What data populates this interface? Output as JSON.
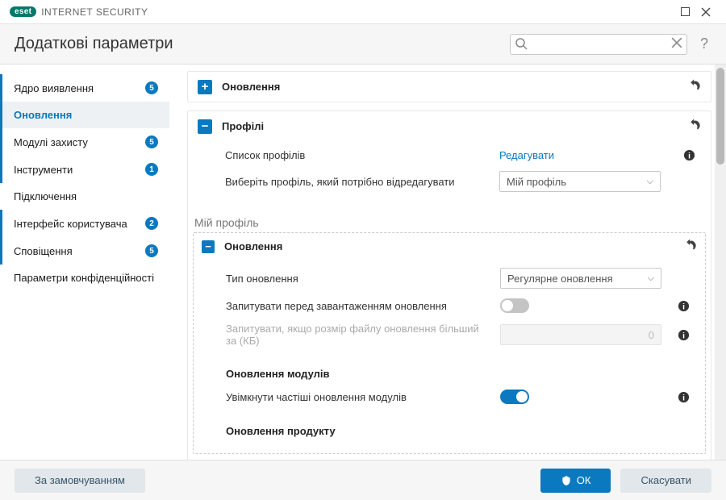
{
  "app": {
    "brand": "eset",
    "product": "INTERNET SECURITY"
  },
  "header": {
    "title": "Додаткові параметри",
    "search_placeholder": ""
  },
  "sidebar": {
    "items": [
      {
        "label": "Ядро виявлення",
        "badge": "5"
      },
      {
        "label": "Оновлення"
      },
      {
        "label": "Модулі захисту",
        "badge": "5"
      },
      {
        "label": "Інструменти",
        "badge": "1"
      },
      {
        "label": "Підключення"
      },
      {
        "label": "Інтерфейс користувача",
        "badge": "2"
      },
      {
        "label": "Сповіщення",
        "badge": "5"
      },
      {
        "label": "Параметри конфіденційності"
      }
    ]
  },
  "panels": {
    "update_collapsed": {
      "title": "Оновлення"
    },
    "profiles": {
      "title": "Профілі",
      "list_label": "Список профілів",
      "edit_link": "Редагувати",
      "select_profile_label": "Виберіть профіль, який потрібно відредагувати",
      "select_profile_value": "Мій профіль",
      "current_profile_label": "Мій профіль"
    },
    "nested_update": {
      "title": "Оновлення",
      "type_label": "Тип оновлення",
      "type_value": "Регулярне оновлення",
      "ask_before_label": "Запитувати перед завантаженням оновлення",
      "ask_size_label": "Запитувати, якщо розмір файлу оновлення більший за (КБ)",
      "ask_size_value": "0",
      "modules_heading": "Оновлення модулів",
      "frequent_label": "Увімкнути частіші оновлення модулів",
      "product_heading": "Оновлення продукту"
    }
  },
  "footer": {
    "default": "За замовчуванням",
    "ok": "ОК",
    "cancel": "Скасувати"
  }
}
